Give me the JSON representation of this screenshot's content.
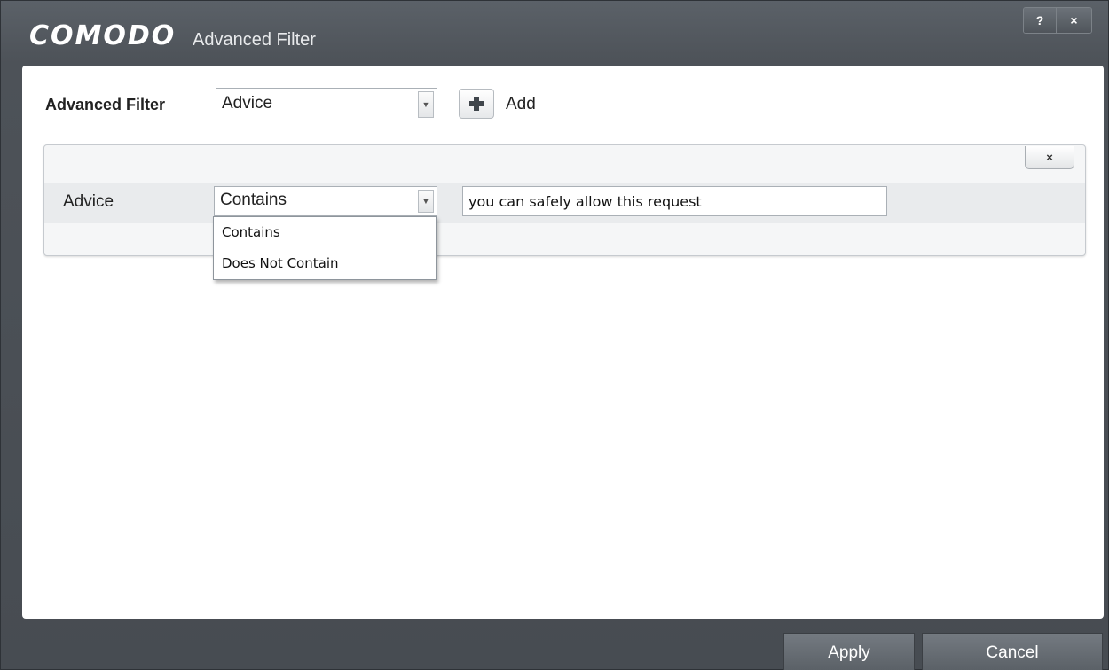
{
  "window": {
    "logo": "COMODO",
    "title": "Advanced Filter",
    "help_label": "?",
    "close_label": "×"
  },
  "filter": {
    "label": "Advanced Filter",
    "selected": "Advice",
    "add_label": "Add"
  },
  "condition": {
    "field_label": "Advice",
    "operator_selected": "Contains",
    "value": "you can safely allow this request",
    "remove_label": "×",
    "operator_options": [
      "Contains",
      "Does Not Contain"
    ]
  },
  "footer": {
    "apply_label": "Apply",
    "cancel_label": "Cancel"
  },
  "icons": {
    "dropdown_arrow": "chevron-down-icon",
    "add": "plus-icon",
    "close": "close-icon",
    "help": "help-icon"
  }
}
